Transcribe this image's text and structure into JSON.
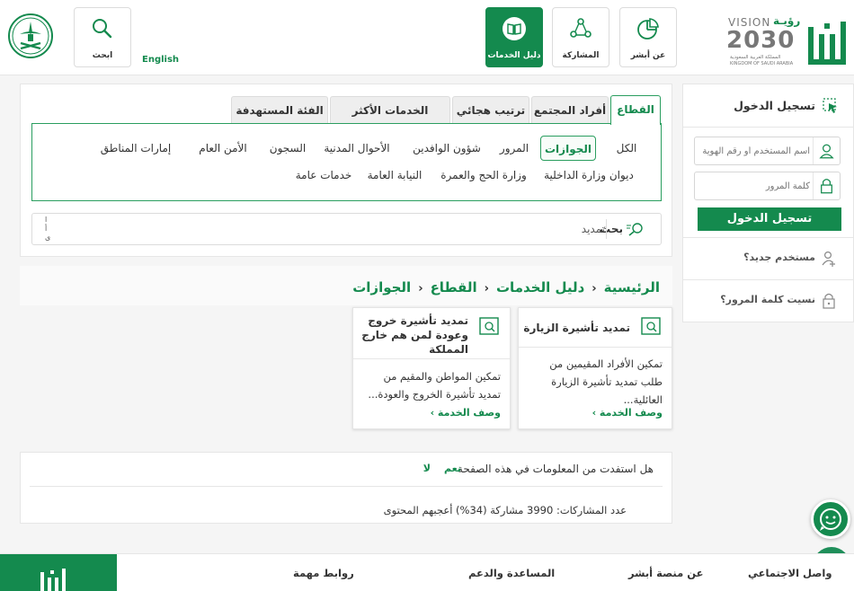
{
  "header": {
    "nav": [
      {
        "label": "عن أبشر",
        "icon": "pie-chart-icon"
      },
      {
        "label": "المشاركة",
        "icon": "share-nodes-icon"
      },
      {
        "label": "دليل الخدمات",
        "icon": "book-icon"
      },
      {
        "label": "ابحث",
        "icon": "search-icon"
      }
    ],
    "language": "English",
    "logo_vision": {
      "line1": "VISION",
      "line2": "2030",
      "arabic": "رؤيـة",
      "sub": "المملكة العربية السعودية",
      "sub_en": "KINGDOM OF SAUDI ARABIA"
    }
  },
  "tabs": [
    "القطاع",
    "أفراد المجتمع",
    "ترتيب هجائي",
    "الخدمات الأكثر استخدامًا",
    "الفئة المستهدفة"
  ],
  "sectors": {
    "row1": [
      "الكل",
      "الجوازات",
      "المرور",
      "شؤون الوافدين",
      "الأحوال المدنية",
      "السجون",
      "الأمن العام",
      "إمارات المناطق"
    ],
    "row2": [
      "ديوان وزارة الداخلية",
      "وزارة الحج والعمرة",
      "النيابة العامة",
      "خدمات عامة"
    ],
    "active": "الجوازات"
  },
  "search": {
    "button": "بحث",
    "value": "تمديد",
    "edge_text": "ا\nأ\nى"
  },
  "breadcrumb": [
    "الرئيسية",
    "دليل الخدمات",
    "القطاع",
    "الجوازات"
  ],
  "cards": [
    {
      "title": "تمديد تأشيرة الزيارة",
      "desc": "تمكين الأفراد المقيمين من طلب تمديد تأشيرة الزيارة العائلية...",
      "more": "وصف الخدمة ›"
    },
    {
      "title": "تمديد تأشيرة خروج وعودة لمن هم خارج المملكة",
      "desc": "تمكين المواطن والمقيم من تمديد تأشيرة الخروج والعودة...",
      "more": "وصف الخدمة ›"
    }
  ],
  "feedback": {
    "question": "هل استفدت من المعلومات في هذه الصفحة",
    "yes": "نعم",
    "no": "لا",
    "count": "عدد المشاركات: 3990 مشاركة (34%) أعجبهم المحتوى"
  },
  "login": {
    "title": "تسجيل الدخول",
    "username_placeholder": "اسم المستخدم أو رقم الهوية",
    "password_placeholder": "كلمة المرور",
    "button": "تسجيل الدخول",
    "new_user": "مستخدم جديد؟",
    "forgot": "نسيت كلمة المرور؟"
  },
  "footer": {
    "columns": [
      "واصل الاجتماعي",
      "عن منصة أبشر",
      "المساعدة والدعم",
      "روابط مهمة"
    ]
  },
  "colors": {
    "primary": "#148a4e",
    "border": "#2a9e5f"
  }
}
